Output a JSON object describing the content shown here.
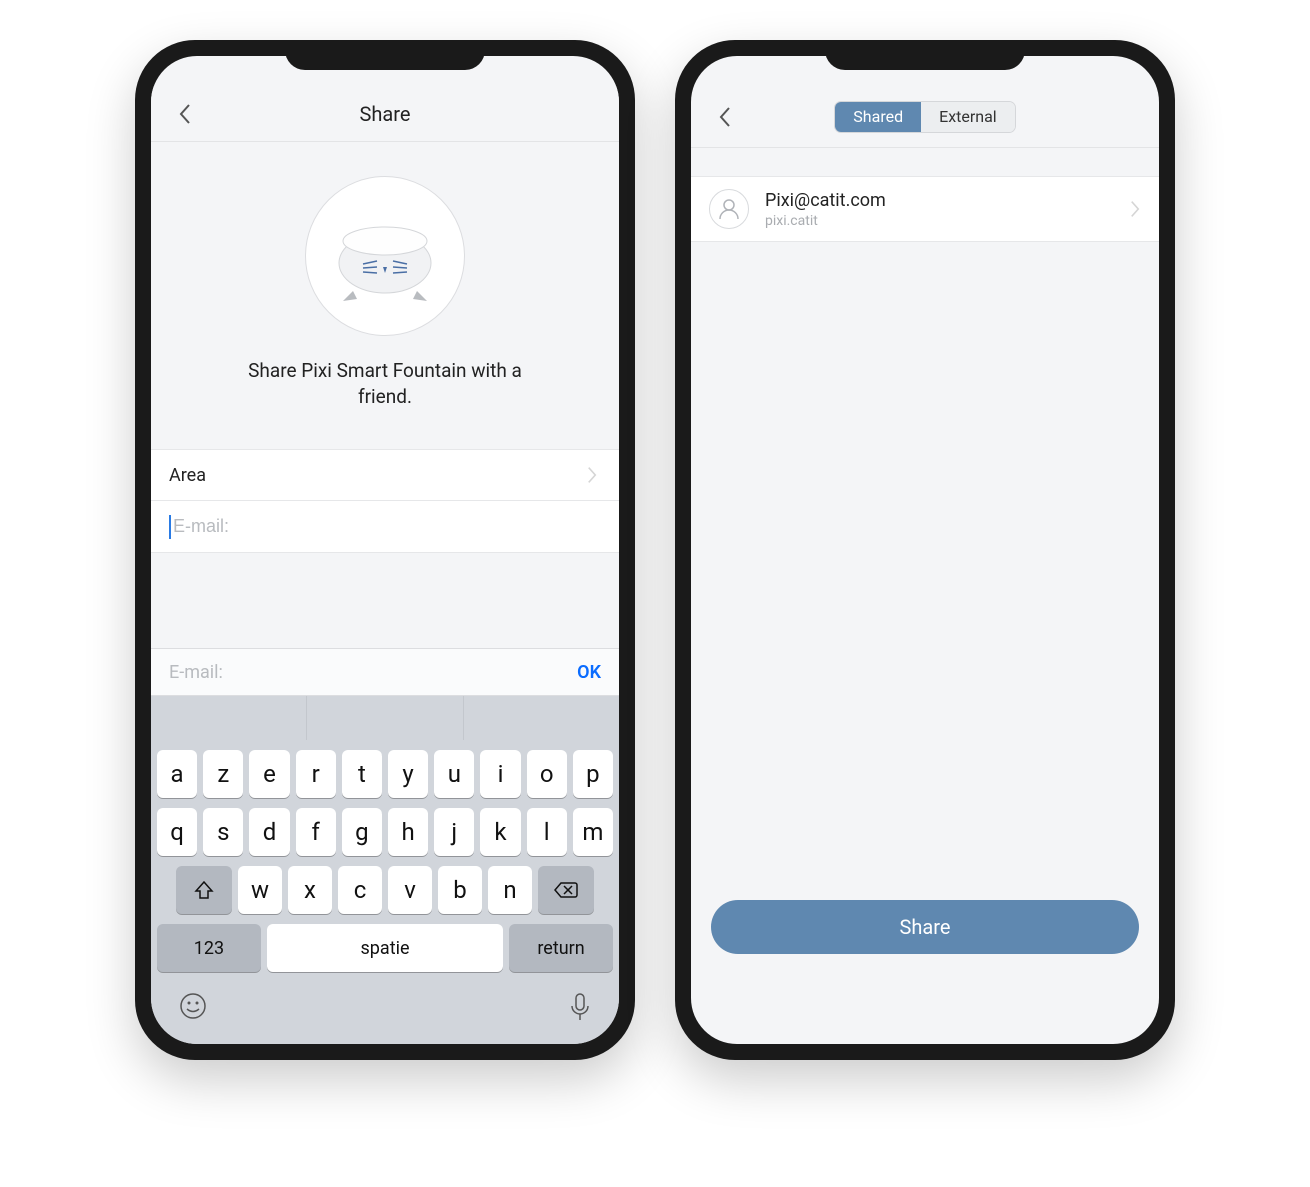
{
  "phone1": {
    "nav_title": "Share",
    "hero_text": "Share Pixi Smart Fountain with a friend.",
    "area_row_label": "Area",
    "email_placeholder": "E-mail:",
    "accessory_placeholder": "E-mail:",
    "accessory_ok": "OK",
    "keyboard": {
      "row1": [
        "a",
        "z",
        "e",
        "r",
        "t",
        "y",
        "u",
        "i",
        "o",
        "p"
      ],
      "row2": [
        "q",
        "s",
        "d",
        "f",
        "g",
        "h",
        "j",
        "k",
        "l",
        "m"
      ],
      "row3": [
        "w",
        "x",
        "c",
        "v",
        "b",
        "n"
      ],
      "num_key": "123",
      "space_key": "spatie",
      "return_key": "return"
    }
  },
  "phone2": {
    "tabs": {
      "shared": "Shared",
      "external": "External"
    },
    "item": {
      "email": "Pixi@catit.com",
      "sub": "pixi.catit"
    },
    "share_button": "Share"
  }
}
